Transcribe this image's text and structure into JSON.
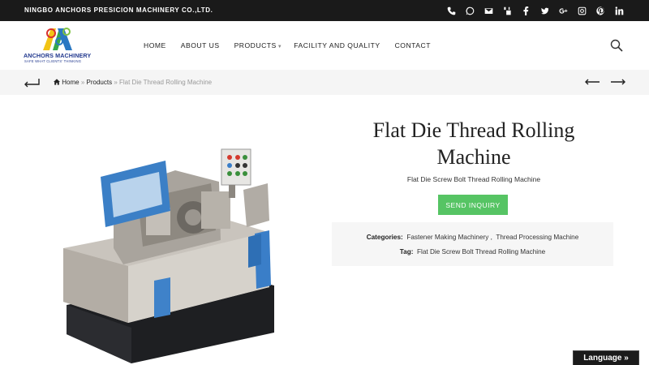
{
  "topbar": {
    "company": "NINGBO ANCHORS PRESICION MACHINERY CO.,LTD.",
    "social": [
      "phone-icon",
      "whatsapp-icon",
      "email-icon",
      "youtube-icon",
      "facebook-icon",
      "twitter-icon",
      "google-plus-icon",
      "instagram-icon",
      "pinterest-icon",
      "linkedin-icon"
    ]
  },
  "logo": {
    "brand": "ANCHORS MACHINERY",
    "slogan": "SAFE WHAT CLIENTS' THINKING"
  },
  "nav": {
    "home": "HOME",
    "about": "ABOUT US",
    "products": "PRODUCTS",
    "facility": "FACILITY AND QUALITY",
    "contact": "CONTACT"
  },
  "breadcrumb": {
    "home": "Home",
    "sep1": "»",
    "products": "Products",
    "sep2": "»",
    "current": "Flat Die Thread Rolling Machine"
  },
  "product": {
    "title": "Flat Die Thread Rolling Machine",
    "subtitle": "Flat Die Screw Bolt Thread Rolling Machine",
    "inquiry_label": "SEND INQUIRY",
    "categories_label": "Categories:",
    "category1": "Fastener Making Machinery",
    "category_sep": ",",
    "category2": "Thread Processing Machine",
    "tag_label": "Tag:",
    "tag1": "Flat Die Screw Bolt Thread Rolling Machine"
  },
  "language_label": "Language »",
  "colors": {
    "topbar": "#1a1a1a",
    "accent_green": "#56c464",
    "logo_blue": "#233a8f",
    "crumb_bg": "#f5f5f5"
  }
}
